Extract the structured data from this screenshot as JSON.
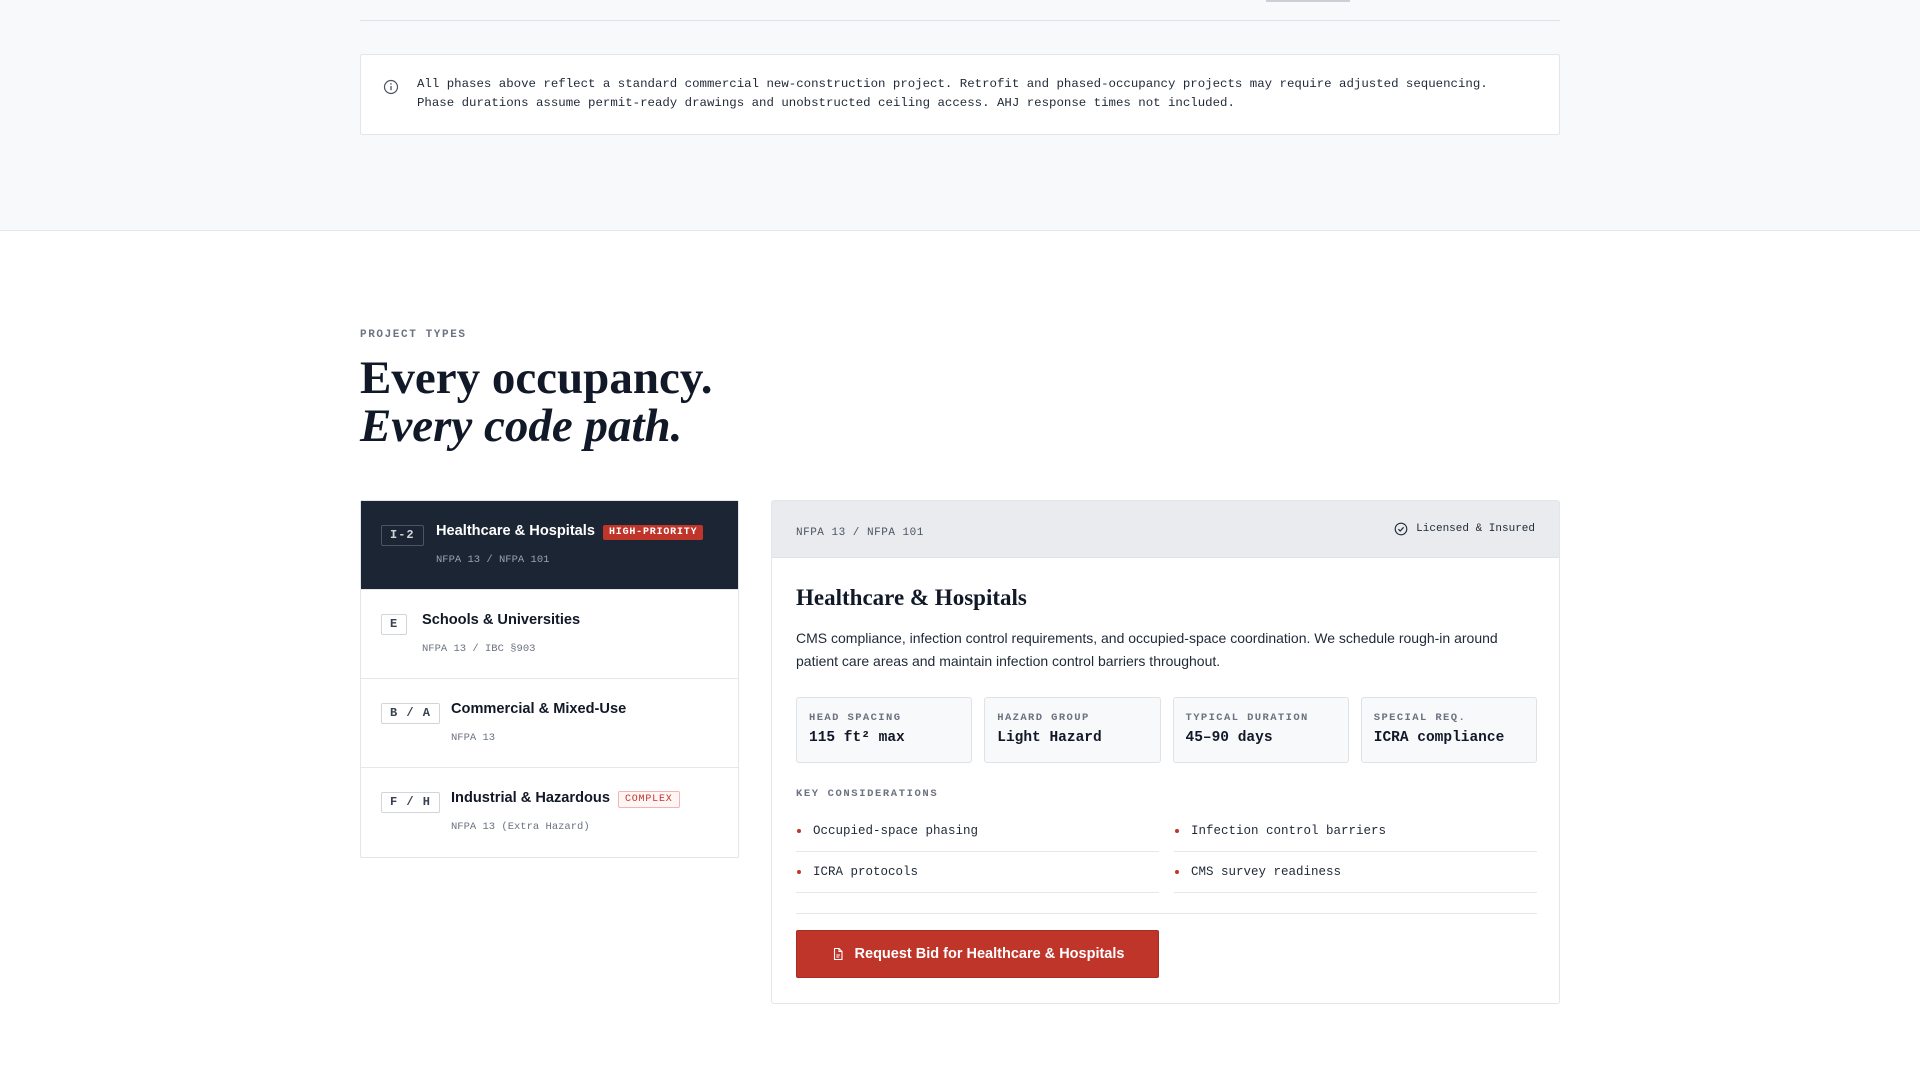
{
  "notice": {
    "text": "All phases above reflect a standard commercial new-construction project. Retrofit and phased-occupancy projects may require adjusted sequencing. Phase durations assume permit-ready drawings and unobstructed ceiling access. AHJ response times not included."
  },
  "section": {
    "eyebrow": "PROJECT TYPES",
    "headline_line1": "Every occupancy.",
    "headline_line2": "Every code path."
  },
  "project_types": [
    {
      "code": "I-2",
      "title": "Healthcare & Hospitals",
      "badge": "HIGH-PRIORITY",
      "codes": "NFPA 13 / NFPA 101",
      "active": true
    },
    {
      "code": "E",
      "title": "Schools & Universities",
      "badge": "",
      "codes": "NFPA 13 / IBC §903",
      "active": false
    },
    {
      "code": "B / A",
      "title": "Commercial & Mixed-Use",
      "badge": "",
      "codes": "NFPA 13",
      "active": false
    },
    {
      "code": "F / H",
      "title": "Industrial & Hazardous",
      "badge": "COMPLEX",
      "codes": "NFPA 13 (Extra Hazard)",
      "active": false
    }
  ],
  "detail": {
    "codes": "NFPA 13 / NFPA 101",
    "licensed": "Licensed & Insured",
    "title": "Healthcare & Hospitals",
    "description": "CMS compliance, infection control requirements, and occupied-space coordination. We schedule rough-in around patient care areas and maintain infection control barriers throughout.",
    "specs": [
      {
        "label": "HEAD SPACING",
        "value": "115 ft² max"
      },
      {
        "label": "HAZARD GROUP",
        "value": "Light Hazard"
      },
      {
        "label": "TYPICAL DURATION",
        "value": "45–90 days"
      },
      {
        "label": "SPECIAL REQ.",
        "value": "ICRA compliance"
      }
    ],
    "considerations_label": "KEY CONSIDERATIONS",
    "considerations": [
      "Occupied-space phasing",
      "Infection control barriers",
      "ICRA protocols",
      "CMS survey readiness"
    ],
    "cta": "Request Bid for Healthcare & Hospitals"
  },
  "colors": {
    "accent": "#c0352a",
    "active_bg": "#1b2533"
  }
}
